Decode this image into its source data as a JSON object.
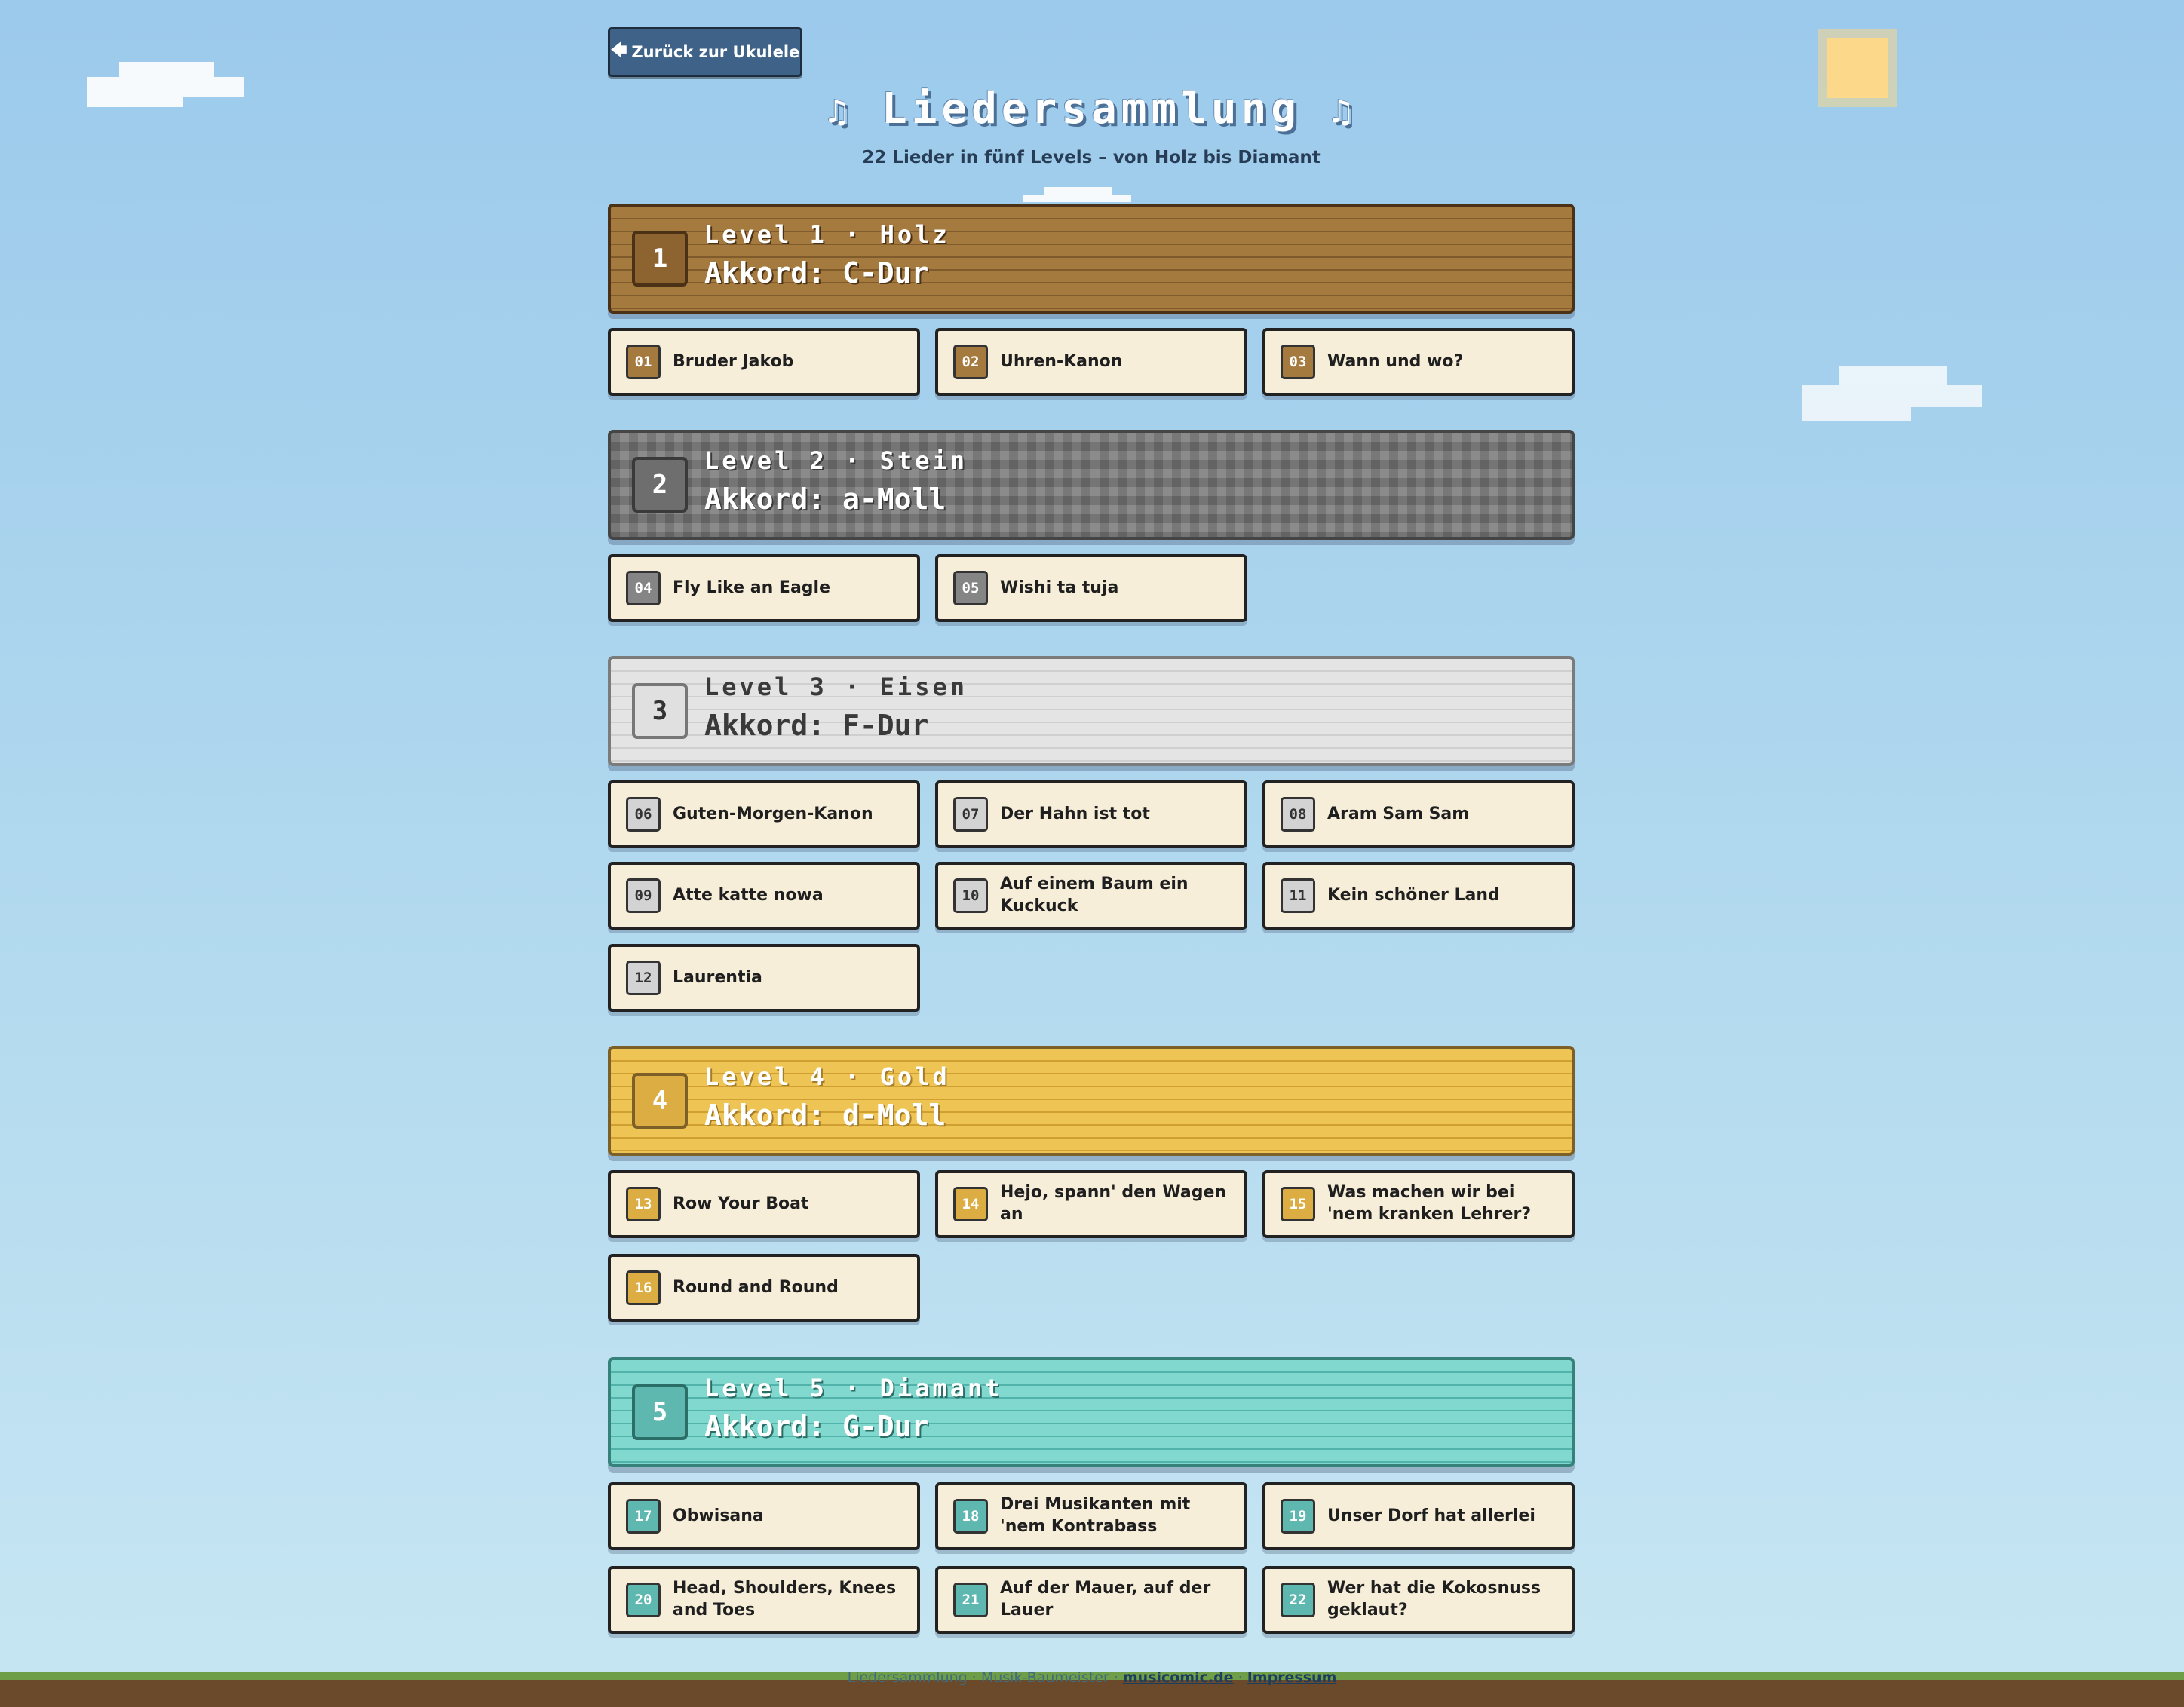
{
  "nav": {
    "back_label": "Zurück zur Ukulele"
  },
  "header": {
    "title": "Liedersammlung",
    "note_symbol": "♫",
    "subtitle": "22 Lieder in fünf Levels – von Holz bis Diamant"
  },
  "levels": [
    {
      "number": "1",
      "name": "Level 1 · Holz",
      "chord": "Akkord: C-Dur",
      "songs": [
        {
          "num": "01",
          "title": "Bruder Jakob"
        },
        {
          "num": "02",
          "title": "Uhren-Kanon"
        },
        {
          "num": "03",
          "title": "Wann und wo?"
        }
      ]
    },
    {
      "number": "2",
      "name": "Level 2 · Stein",
      "chord": "Akkord: a-Moll",
      "songs": [
        {
          "num": "04",
          "title": "Fly Like an Eagle"
        },
        {
          "num": "05",
          "title": "Wishi ta tuja"
        }
      ]
    },
    {
      "number": "3",
      "name": "Level 3 · Eisen",
      "chord": "Akkord: F-Dur",
      "songs": [
        {
          "num": "06",
          "title": "Guten-Morgen-Kanon"
        },
        {
          "num": "07",
          "title": "Der Hahn ist tot"
        },
        {
          "num": "08",
          "title": "Aram Sam Sam"
        },
        {
          "num": "09",
          "title": "Atte katte nowa"
        },
        {
          "num": "10",
          "title": "Auf einem Baum ein Kuckuck"
        },
        {
          "num": "11",
          "title": "Kein schöner Land"
        },
        {
          "num": "12",
          "title": "Laurentia"
        }
      ]
    },
    {
      "number": "4",
      "name": "Level 4 · Gold",
      "chord": "Akkord: d-Moll",
      "songs": [
        {
          "num": "13",
          "title": "Row Your Boat"
        },
        {
          "num": "14",
          "title": "Hejo, spann' den Wagen an"
        },
        {
          "num": "15",
          "title": "Was machen wir bei 'nem kranken Lehrer?"
        },
        {
          "num": "16",
          "title": "Round and Round"
        }
      ]
    },
    {
      "number": "5",
      "name": "Level 5 · Diamant",
      "chord": "Akkord: G-Dur",
      "songs": [
        {
          "num": "17",
          "title": "Obwisana"
        },
        {
          "num": "18",
          "title": "Drei Musikanten mit 'nem Kontrabass"
        },
        {
          "num": "19",
          "title": "Unser Dorf hat allerlei"
        },
        {
          "num": "20",
          "title": "Head, Shoulders, Knees and Toes"
        },
        {
          "num": "21",
          "title": "Auf der Mauer, auf der Lauer"
        },
        {
          "num": "22",
          "title": "Wer hat die Kokosnuss geklaut?"
        }
      ]
    }
  ],
  "footer": {
    "text": "Liedersammlung · Musik-Baumeister ·",
    "link1": "musicomic.de",
    "sep": "·",
    "link2": "Impressum"
  }
}
